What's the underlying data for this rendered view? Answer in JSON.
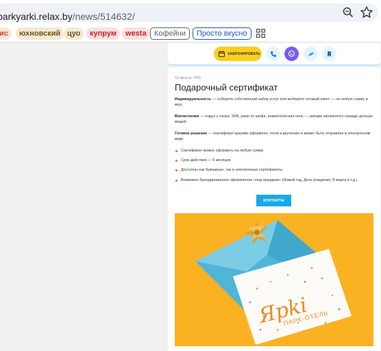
{
  "browser": {
    "url_host": "parkyarki.relax.by",
    "url_path": "/news/514632/",
    "icons": [
      "zoom-icon",
      "star-icon",
      "apps-icon"
    ]
  },
  "bookmarks": [
    {
      "label": "ис"
    },
    {
      "label": "юхновский"
    },
    {
      "label": "цуо"
    },
    {
      "label": "купрум"
    },
    {
      "label": "westa"
    },
    {
      "label": "Кофейни"
    },
    {
      "label": "Просто вкусно"
    }
  ],
  "sticky_bar": {
    "book_label": "ЗАБРОНИРОВАТЬ",
    "icons": [
      "phone-icon",
      "viber-icon",
      "instagram-icon",
      "bookmark-icon"
    ]
  },
  "article": {
    "date": "23 августа, 2026",
    "title": "Подарочный сертификат",
    "p1_bold": "Индивидуальность",
    "p1_text": " — соберите собственный набор услуг или выберите готовый пакет — на любую сумму и вкус.",
    "p2_bold": "Впечатления",
    "p2_text": " — отдых у озера, SPA, ужин от шефа, романтическая ночь — эмоции запомнятся гораздо дольше вещей.",
    "p3_bold": "Готовое решение",
    "p3_text": " — сертификат красиво оформлен, готов к вручению и может быть отправлен в электронном виде.",
    "bullets": [
      "Сертификат можно оформить на любую сумму",
      "Срок действия — 6 месяцев",
      "Доступны как бумажные, так и электронные сертификаты",
      "Возможно брендированное оформление «под праздник» (Новый год, День рождения, 8 марта и т.д.)"
    ],
    "cta_label": "КОНТАКТЫ",
    "image_logo_text": "Ярki",
    "image_logo_sub": "ПАРК-ОТЕЛЬ"
  },
  "colors": {
    "accent_yellow": "#fbcf1f",
    "cta_blue": "#18a9e6",
    "viber_purple": "#7a5cf0",
    "photo_bg": "#fbb222"
  }
}
